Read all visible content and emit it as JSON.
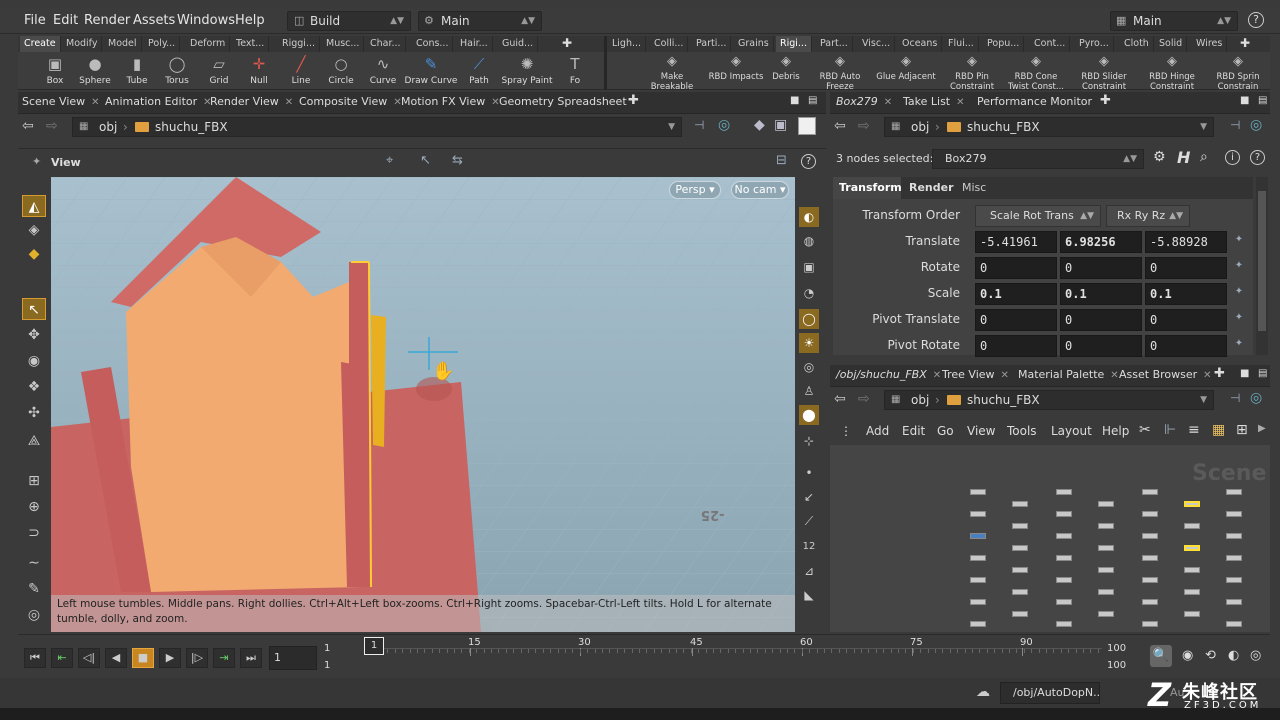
{
  "menubar": {
    "items": [
      "File",
      "Edit",
      "Render",
      "Assets",
      "Windows",
      "Help"
    ],
    "desktop": "Build",
    "context": "Main",
    "right_context": "Main",
    "help_icon": "help-icon"
  },
  "shelf": {
    "left_tabs": [
      "Create",
      "Modify",
      "Model",
      "Poly...",
      "Deform",
      "Text...",
      "Riggi...",
      "Musc...",
      "Char...",
      "Cons...",
      "Hair...",
      "Guid..."
    ],
    "right_tabs": [
      "Ligh...",
      "Colli...",
      "Parti...",
      "Grains",
      "Rigi...",
      "Part...",
      "Visc...",
      "Oceans",
      "Flui...",
      "Popu...",
      "Cont...",
      "Pyro...",
      "Cloth",
      "Solid",
      "Wires"
    ],
    "left_tools": [
      {
        "label": "Box",
        "icon": "box-icon"
      },
      {
        "label": "Sphere",
        "icon": "sphere-icon"
      },
      {
        "label": "Tube",
        "icon": "tube-icon"
      },
      {
        "label": "Torus",
        "icon": "torus-icon"
      },
      {
        "label": "Grid",
        "icon": "grid-icon"
      },
      {
        "label": "Null",
        "icon": "null-icon"
      },
      {
        "label": "Line",
        "icon": "line-icon"
      },
      {
        "label": "Circle",
        "icon": "circle-icon"
      },
      {
        "label": "Curve",
        "icon": "curve-icon"
      },
      {
        "label": "Draw Curve",
        "icon": "draw-curve-icon"
      },
      {
        "label": "Path",
        "icon": "path-icon"
      },
      {
        "label": "Spray Paint",
        "icon": "spray-paint-icon"
      },
      {
        "label": "Fo",
        "icon": "font-icon"
      }
    ],
    "right_tools": [
      {
        "label": "Make Breakable",
        "icon": "make-breakable-icon"
      },
      {
        "label": "RBD Impacts",
        "icon": "rbd-impacts-icon"
      },
      {
        "label": "Debris",
        "icon": "debris-icon"
      },
      {
        "label": "RBD Auto Freeze",
        "icon": "rbd-auto-freeze-icon"
      },
      {
        "label": "Glue Adjacent",
        "icon": "glue-adjacent-icon"
      },
      {
        "label": "RBD Pin Constraint",
        "icon": "rbd-pin-icon"
      },
      {
        "label": "RBD Cone Twist Const...",
        "icon": "rbd-cone-icon"
      },
      {
        "label": "RBD Slider Constraint",
        "icon": "rbd-slider-icon"
      },
      {
        "label": "RBD Hinge Constraint",
        "icon": "rbd-hinge-icon"
      },
      {
        "label": "RBD Sprin Constrain",
        "icon": "rbd-spring-icon"
      }
    ]
  },
  "left_pane": {
    "tabs": [
      "Scene View",
      "Animation Editor",
      "Render View",
      "Composite View",
      "Motion FX View",
      "Geometry Spreadsheet"
    ],
    "path_root": "obj",
    "path_node": "shuchu_FBX",
    "view_label": "View",
    "persp_label": "Persp",
    "cam_label": "No cam",
    "grid_number": "-25",
    "hint": "Left mouse tumbles. Middle pans. Right dollies. Ctrl+Alt+Left box-zooms. Ctrl+Right zooms. Spacebar-Ctrl-Left tilts. Hold L for alternate tumble, dolly, and zoom."
  },
  "param_pane": {
    "tabs": [
      "Box279",
      "Take List",
      "Performance Monitor"
    ],
    "path_root": "obj",
    "path_node": "shuchu_FBX",
    "selected_text": "3 nodes selected:",
    "selected_node": "Box279",
    "subtabs": [
      "Transform",
      "Render",
      "Misc"
    ],
    "transform_order_label": "Transform Order",
    "transform_order": "Scale Rot Trans",
    "rot_order": "Rx Ry Rz",
    "rows": [
      {
        "label": "Translate",
        "values": [
          "-5.41961",
          "6.98256",
          "-5.88928"
        ]
      },
      {
        "label": "Rotate",
        "values": [
          "0",
          "0",
          "0"
        ]
      },
      {
        "label": "Scale",
        "values": [
          "0.1",
          "0.1",
          "0.1"
        ]
      },
      {
        "label": "Pivot Translate",
        "values": [
          "0",
          "0",
          "0"
        ]
      },
      {
        "label": "Pivot Rotate",
        "values": [
          "0",
          "0",
          "0"
        ]
      }
    ]
  },
  "network_pane": {
    "tabs": [
      "/obj/shuchu_FBX",
      "Tree View",
      "Material Palette",
      "Asset Browser"
    ],
    "path_root": "obj",
    "path_node": "shuchu_FBX",
    "menu": [
      "Add",
      "Edit",
      "Go",
      "View",
      "Tools",
      "Layout",
      "Help"
    ],
    "watermark": "Scene"
  },
  "timeline": {
    "current_frame": "1",
    "start_frame": "1",
    "start_frame_2": "1",
    "end_frame": "100",
    "end_frame_2": "100",
    "ticks": [
      "1",
      "15",
      "30",
      "45",
      "60",
      "75",
      "90"
    ]
  },
  "statusbar": {
    "path": "/obj/AutoDopN...",
    "auto_label": "Au"
  },
  "logo": {
    "text": "朱峰社区",
    "sub": "ZF3D.COM"
  }
}
